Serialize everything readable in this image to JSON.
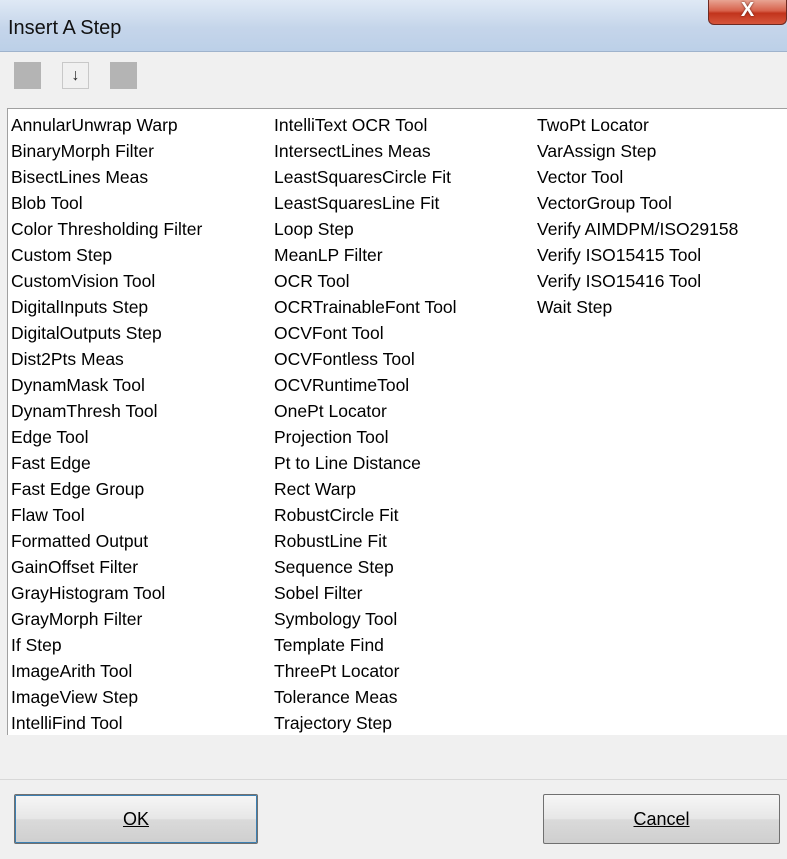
{
  "window": {
    "title": "Insert A Step",
    "close_glyph": "X"
  },
  "toolbar": {
    "down_arrow_glyph": "↓"
  },
  "list": {
    "columns": [
      [
        "AnnularUnwrap Warp",
        "BinaryMorph Filter",
        "BisectLines Meas",
        "Blob Tool",
        "Color Thresholding Filter",
        "Custom Step",
        "CustomVision Tool",
        "DigitalInputs Step",
        "DigitalOutputs Step",
        "Dist2Pts Meas",
        "DynamMask Tool",
        "DynamThresh Tool",
        "Edge Tool",
        "Fast Edge",
        "Fast Edge Group",
        "Flaw Tool",
        "Formatted Output",
        "GainOffset Filter",
        "GrayHistogram Tool",
        "GrayMorph Filter",
        "If Step",
        "ImageArith Tool",
        "ImageView Step",
        "IntelliFind Tool"
      ],
      [
        "IntelliText OCR Tool",
        "IntersectLines Meas",
        "LeastSquaresCircle Fit",
        "LeastSquaresLine Fit",
        "Loop Step",
        "MeanLP Filter",
        "OCR Tool",
        "OCRTrainableFont Tool",
        "OCVFont Tool",
        "OCVFontless Tool",
        "OCVRuntimeTool",
        "OnePt Locator",
        "Projection Tool",
        "Pt to Line Distance",
        "Rect Warp",
        "RobustCircle Fit",
        "RobustLine Fit",
        "Sequence Step",
        "Sobel Filter",
        "Symbology Tool",
        "Template Find",
        "ThreePt Locator",
        "Tolerance Meas",
        "Trajectory Step"
      ],
      [
        "TwoPt Locator",
        "VarAssign Step",
        "Vector Tool",
        "VectorGroup Tool",
        "Verify AIMDPM/ISO29158",
        "Verify ISO15415 Tool",
        "Verify ISO15416 Tool",
        "Wait Step"
      ]
    ]
  },
  "buttons": {
    "ok_label": "OK",
    "cancel_label": "Cancel"
  }
}
